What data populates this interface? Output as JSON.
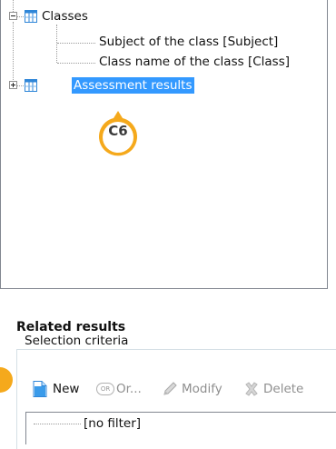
{
  "tree": {
    "nodes": [
      {
        "label": "Classes",
        "expander": "minus",
        "icon": "table-icon"
      },
      {
        "label": "Subject of the class [Subject]"
      },
      {
        "label": "Class name of the class [Class]"
      },
      {
        "label": "Assessment results",
        "expander": "plus",
        "icon": "table-icon",
        "selected": true
      }
    ]
  },
  "callout": {
    "text": "C6",
    "color": "#f5a91c"
  },
  "related": {
    "title": "Related results",
    "subtitle": "Selection criteria"
  },
  "toolbar": {
    "new_label": "New",
    "or_badge": "OR",
    "or_label": "Or...",
    "modify_label": "Modify",
    "delete_label": "Delete"
  },
  "filter_list": {
    "items": [
      "[no filter]"
    ]
  },
  "colors": {
    "selection": "#3399ff",
    "accent": "#f5a91c"
  }
}
